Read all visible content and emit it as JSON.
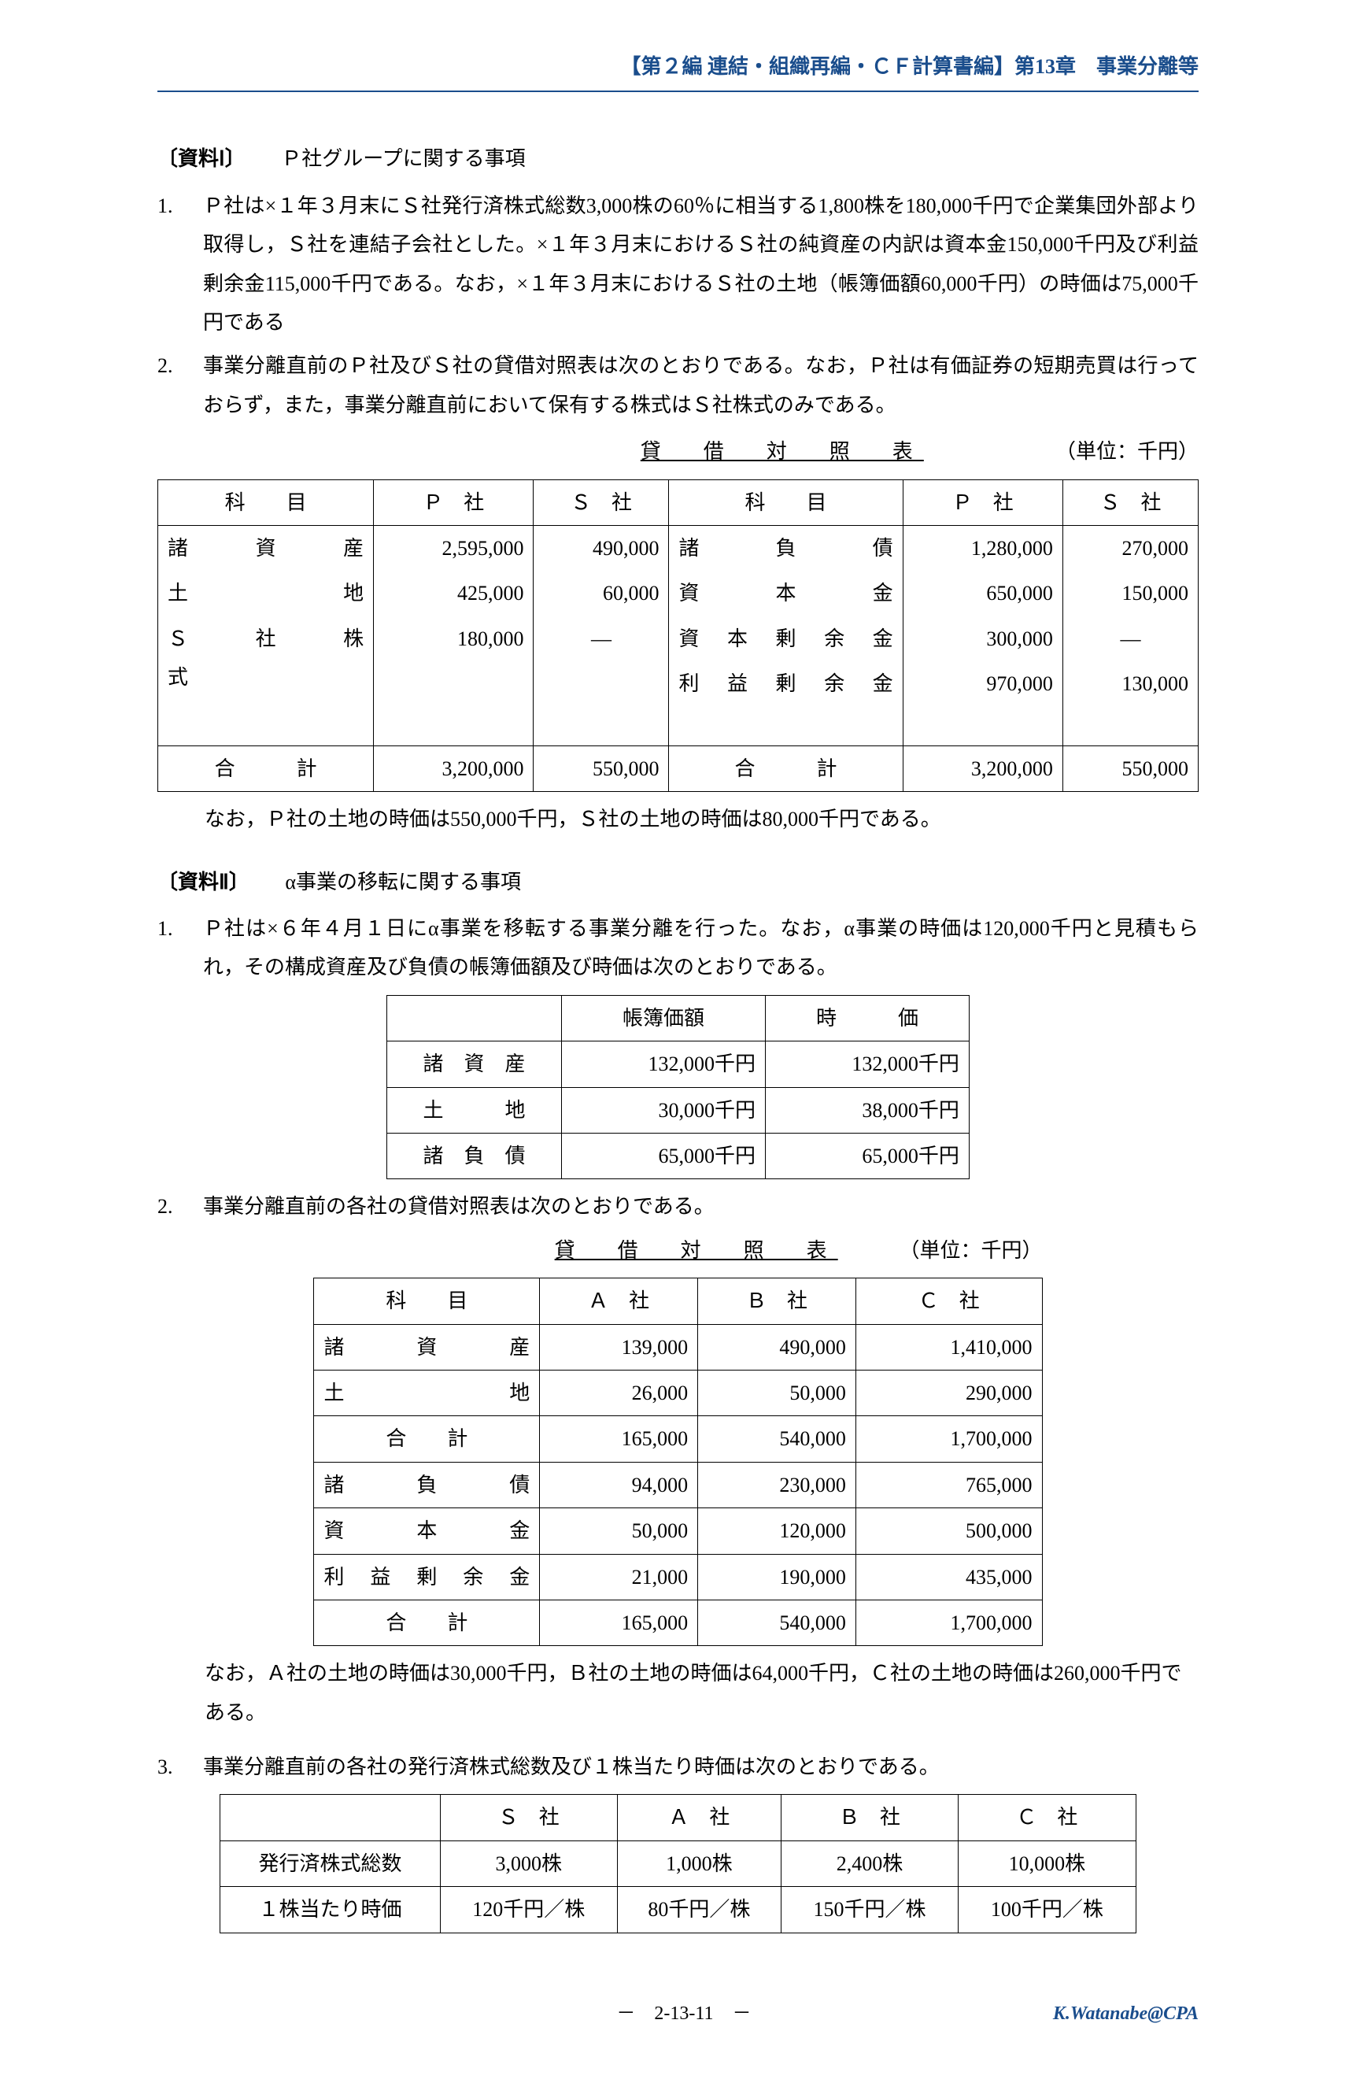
{
  "header": "【第２編 連結・組織再編・ＣＦ計算書編】第13章　事業分離等",
  "section1": {
    "title_prefix": "〔資料Ⅰ〕",
    "title": "Ｐ社グループに関する事項",
    "items": [
      "Ｐ社は×１年３月末にＳ社発行済株式総数3,000株の60％に相当する1,800株を180,000千円で企業集団外部より取得し，Ｓ社を連結子会社とした。×１年３月末におけるＳ社の純資産の内訳は資本金150,000千円及び利益剰余金115,000千円である。なお，×１年３月末におけるＳ社の土地（帳簿価額60,000千円）の時価は75,000千円である",
      "事業分離直前のＰ社及びＳ社の貸借対照表は次のとおりである。なお，Ｐ社は有価証券の短期売買は行っておらず，また，事業分離直前において保有する株式はＳ社株式のみである。"
    ],
    "bs": {
      "caption": "貸　借　対　照　表",
      "unit": "（単位：千円）",
      "h_left": "科　　目",
      "h_p": "Ｐ　社",
      "h_s": "Ｓ　社",
      "h_right": "科　　目",
      "rows_left": [
        {
          "n": "諸　　　資　　　産",
          "p": "2,595,000",
          "s": "490,000"
        },
        {
          "n": "土　　　　　　　地",
          "p": "425,000",
          "s": "60,000"
        },
        {
          "n": "Ｓ　　社　　株　　式",
          "p": "180,000",
          "s": "―"
        }
      ],
      "rows_right": [
        {
          "n": "諸　　　負　　　債",
          "p": "1,280,000",
          "s": "270,000"
        },
        {
          "n": "資　　　本　　　金",
          "p": "650,000",
          "s": "150,000"
        },
        {
          "n": "資　本　剰　余　金",
          "p": "300,000",
          "s": "―"
        },
        {
          "n": "利　益　剰　余　金",
          "p": "970,000",
          "s": "130,000"
        }
      ],
      "total_label": "合　　　計",
      "total_p": "3,200,000",
      "total_s": "550,000"
    },
    "note": "なお，Ｐ社の土地の時価は550,000千円，Ｓ社の土地の時価は80,000千円である。"
  },
  "section2": {
    "title_prefix": "〔資料Ⅱ〕",
    "title": "α事業の移転に関する事項",
    "items": [
      "Ｐ社は×６年４月１日にα事業を移転する事業分離を行った。なお，α事業の時価は120,000千円と見積もられ，その構成資産及び負債の帳簿価額及び時価は次のとおりである。",
      "事業分離直前の各社の貸借対照表は次のとおりである。",
      "事業分離直前の各社の発行済株式総数及び１株当たり時価は次のとおりである。"
    ],
    "tbl1": {
      "h1": "帳簿価額",
      "h2": "時　　　価",
      "rows": [
        {
          "n": "諸　資　産",
          "a": "132,000千円",
          "b": "132,000千円"
        },
        {
          "n": "土　　　地",
          "a": "30,000千円",
          "b": "38,000千円"
        },
        {
          "n": "諸　負　債",
          "a": "65,000千円",
          "b": "65,000千円"
        }
      ]
    },
    "bs2": {
      "caption": "貸　借　対　照　表",
      "unit": "（単位：千円）",
      "h_left": "科　　目",
      "h_a": "Ａ　社",
      "h_b": "Ｂ　社",
      "h_c": "Ｃ　社",
      "rows": [
        {
          "n": "諸　　　資　　　産",
          "a": "139,000",
          "b": "490,000",
          "c": "1,410,000"
        },
        {
          "n": "土　　　　　　　地",
          "a": "26,000",
          "b": "50,000",
          "c": "290,000"
        },
        {
          "n": "合　　計",
          "a": "165,000",
          "b": "540,000",
          "c": "1,700,000",
          "sum": true
        },
        {
          "n": "諸　　　負　　　債",
          "a": "94,000",
          "b": "230,000",
          "c": "765,000"
        },
        {
          "n": "資　　　本　　　金",
          "a": "50,000",
          "b": "120,000",
          "c": "500,000"
        },
        {
          "n": "利　益　剰　余　金",
          "a": "21,000",
          "b": "190,000",
          "c": "435,000"
        },
        {
          "n": "合　　計",
          "a": "165,000",
          "b": "540,000",
          "c": "1,700,000",
          "sum": true
        }
      ]
    },
    "note2": "なお，Ａ社の土地の時価は30,000千円，Ｂ社の土地の時価は64,000千円，Ｃ社の土地の時価は260,000千円である。",
    "tbl3": {
      "h": [
        "",
        "Ｓ　社",
        "Ａ　社",
        "Ｂ　社",
        "Ｃ　社"
      ],
      "rows": [
        {
          "n": "発行済株式総数",
          "s": "3,000株",
          "a": "1,000株",
          "b": "2,400株",
          "c": "10,000株"
        },
        {
          "n": "１株当たり時価",
          "s": "120千円／株",
          "a": "80千円／株",
          "b": "150千円／株",
          "c": "100千円／株"
        }
      ]
    }
  },
  "footer": {
    "page": "－　2-13-11　－",
    "copyright": "K.Watanabe@CPA"
  }
}
